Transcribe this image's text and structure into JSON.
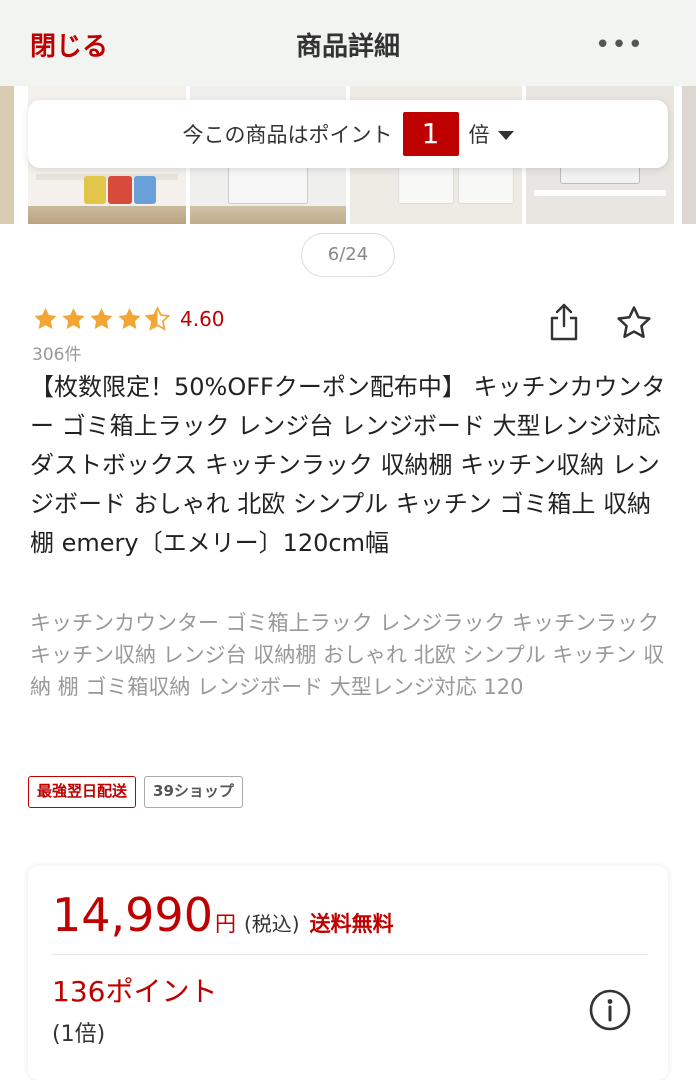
{
  "header": {
    "close_label": "閉じる",
    "title": "商品詳細",
    "more_label": "•••"
  },
  "points_banner": {
    "prefix": "今この商品はポイント",
    "multiplier": "1",
    "suffix": "倍"
  },
  "gallery": {
    "counter": "6/24"
  },
  "rating": {
    "value": "4.60",
    "stars": 4.6,
    "review_count": "306件"
  },
  "product": {
    "title": "【枚数限定！50%OFFクーポン配布中】 キッチンカウンター ゴミ箱上ラック レンジ台 レンジボード 大型レンジ対応 ダストボックス キッチンラック 収納棚 キッチン収納 レンジボード おしゃれ 北欧 シンプル キッチン ゴミ箱上 収納 棚 emery〔エメリー〕120cm幅",
    "catch_copy": "キッチンカウンター ゴミ箱上ラック レンジラック キッチンラック キッチン収納 レンジ台 収納棚 おしゃれ 北欧 シンプル キッチン 収納 棚 ゴミ箱収納 レンジボード 大型レンジ対応 120"
  },
  "tags": {
    "fast_delivery": "最強翌日配送",
    "shop39": "39ショップ"
  },
  "price": {
    "amount": "14,990",
    "currency": "円",
    "tax_note": "(税込)",
    "shipping": "送料無料",
    "points": "136ポイント",
    "points_multiplier": "(1倍)"
  },
  "colors": {
    "brand_red": "#bf0000",
    "star_gold": "#f3a633"
  }
}
